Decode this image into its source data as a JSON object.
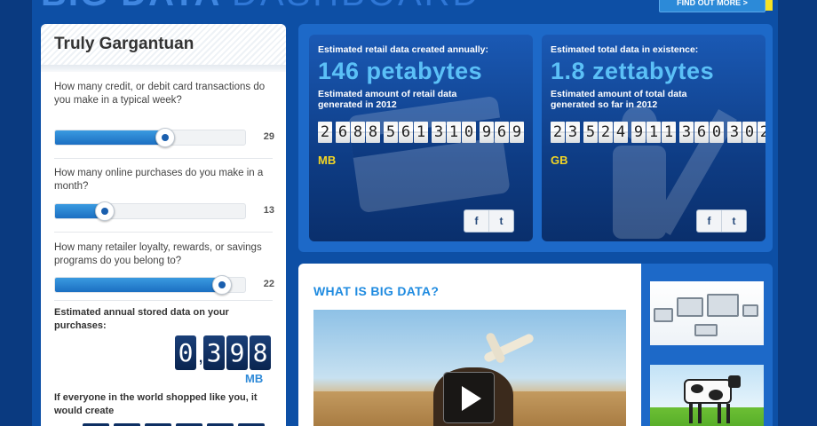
{
  "header": {
    "title_bold": "BIG DATA",
    "title_thin": "DASHBOARD",
    "find_out_more": "FIND OUT MORE >"
  },
  "left_panel": {
    "title": "Truly Gargantuan",
    "questions": [
      {
        "text": "How many credit, or debit card transactions do you make in a typical week?",
        "value": "29",
        "fill_fraction": 0.58
      },
      {
        "text": "How many online purchases do you make in a month?",
        "value": "13",
        "fill_fraction": 0.26
      },
      {
        "text": "How many retailer loyalty, rewards, or savings programs do you belong to?",
        "value": "22",
        "fill_fraction": 0.88
      }
    ],
    "stored_label": "Estimated annual stored data on your purchases:",
    "stored_digits": [
      "0",
      "3",
      "9",
      "8"
    ],
    "stored_unit": "MB",
    "if_label": "If everyone in the world shopped like you, it would create"
  },
  "stats": [
    {
      "label": "Estimated retail data created annually:",
      "big": "146 petabytes",
      "sub": "Estimated amount of retail data generated in 2012",
      "groups": [
        [
          "2"
        ],
        [
          "6",
          "8",
          "8"
        ],
        [
          "5",
          "6",
          "1"
        ],
        [
          "3",
          "1",
          "0"
        ],
        [
          "9",
          "6",
          "9"
        ]
      ],
      "unit": "MB"
    },
    {
      "label": "Estimated total data in existence:",
      "big": "1.8 zettabytes",
      "sub": "Estimated amount of total data generated so far in 2012",
      "groups": [
        [
          "2",
          "3"
        ],
        [
          "5",
          "2",
          "4"
        ],
        [
          "9",
          "1",
          "1"
        ],
        [
          "3",
          "6",
          "0"
        ],
        [
          "3",
          "0",
          "2"
        ]
      ],
      "unit": "GB"
    }
  ],
  "share": {
    "facebook": "f",
    "twitter": "t"
  },
  "what_is": {
    "title": "WHAT IS BIG DATA?"
  }
}
